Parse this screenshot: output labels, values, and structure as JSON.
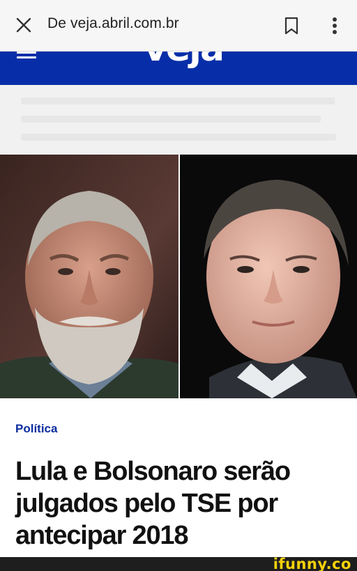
{
  "browser": {
    "url_text": "De veja.abril.com.br",
    "close_icon": "close-icon",
    "bookmark_icon": "bookmark-icon",
    "menu_icon": "more-vert-icon"
  },
  "site": {
    "logo_text": "veja",
    "brand_color": "#072ea8",
    "menu_icon": "hamburger-icon"
  },
  "article": {
    "category": "Política",
    "headline": "Lula e Bolsonaro serão julgados pelo TSE por antecipar 2018"
  },
  "watermark": {
    "text": "ifunny.co",
    "color": "#f5d20a"
  }
}
